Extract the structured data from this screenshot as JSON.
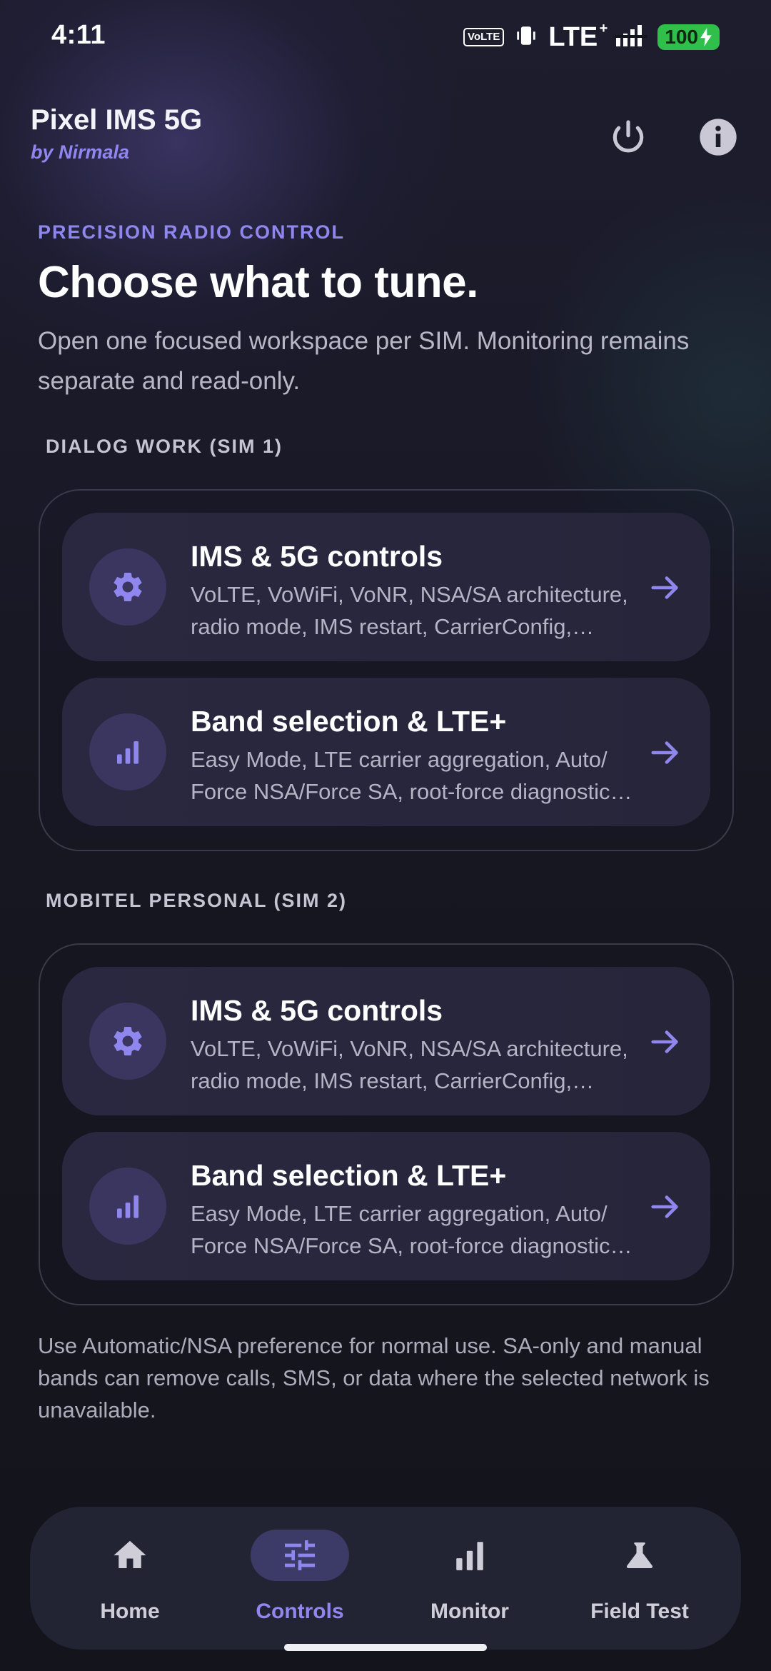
{
  "status_bar": {
    "time": "4:11",
    "volte": "VoLTE",
    "network": "LTE",
    "network_plus": "+",
    "battery": "100"
  },
  "header": {
    "title": "Pixel IMS 5G",
    "subtitle": "by Nirmala",
    "power_icon": "power-icon",
    "info_icon": "info-icon"
  },
  "hero": {
    "eyebrow": "PRECISION RADIO CONTROL",
    "title": "Choose what to tune.",
    "description": "Open one focused workspace per SIM. Monitoring remains separate and read-only."
  },
  "sims": [
    {
      "label": "DIALOG WORK (SIM 1)",
      "cards": [
        {
          "icon": "gear-icon",
          "title": "IMS & 5G controls",
          "description": "VoLTE, VoWiFi, VoNR, NSA/SA architecture, radio mode, IMS restart, CarrierConfig, experimental"
        },
        {
          "icon": "signal-bars-icon",
          "title": "Band selection & LTE+",
          "description": "Easy Mode, LTE carrier aggregation, Auto/ Force NSA/Force SA, root-force diagnostics and more"
        }
      ]
    },
    {
      "label": "MOBITEL PERSONAL (SIM 2)",
      "cards": [
        {
          "icon": "gear-icon",
          "title": "IMS & 5G controls",
          "description": "VoLTE, VoWiFi, VoNR, NSA/SA architecture, radio mode, IMS restart, CarrierConfig, experimental"
        },
        {
          "icon": "signal-bars-icon",
          "title": "Band selection & LTE+",
          "description": "Easy Mode, LTE carrier aggregation, Auto/ Force NSA/Force SA, root-force diagnostics and more"
        }
      ]
    }
  ],
  "footnote": "Use Automatic/NSA preference for normal use. SA-only and manual bands can remove calls, SMS, or data where the selected network is unavailable.",
  "nav": {
    "items": [
      {
        "label": "Home",
        "icon": "home-icon",
        "active": false
      },
      {
        "label": "Controls",
        "icon": "sliders-icon",
        "active": true
      },
      {
        "label": "Monitor",
        "icon": "bar-chart-icon",
        "active": false
      },
      {
        "label": "Field Test",
        "icon": "flask-icon",
        "active": false
      }
    ]
  },
  "colors": {
    "accent": "#8f86ee",
    "background": "#15151f",
    "card": "#2a2840",
    "battery": "#2fbf4a"
  }
}
